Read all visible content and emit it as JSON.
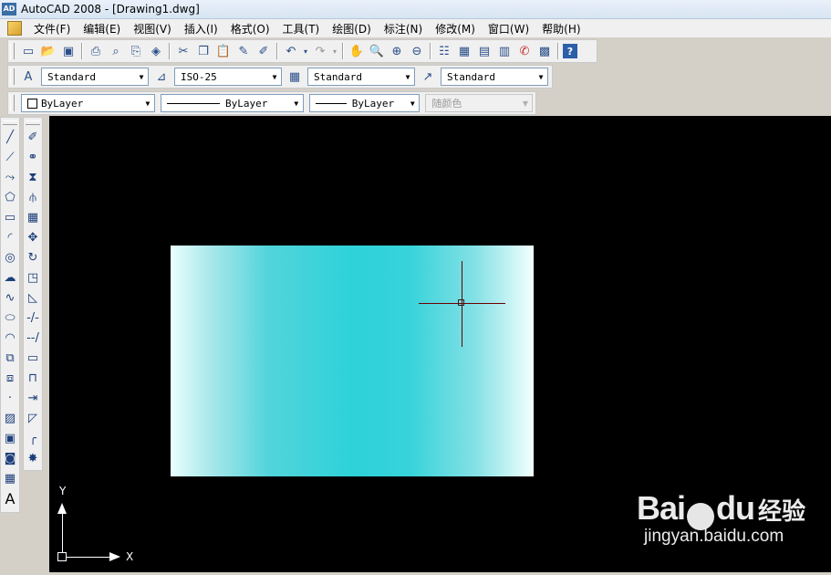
{
  "window": {
    "title": "AutoCAD 2008 - [Drawing1.dwg]",
    "logo_text": "AD"
  },
  "menu": {
    "items": [
      "文件(F)",
      "编辑(E)",
      "视图(V)",
      "插入(I)",
      "格式(O)",
      "工具(T)",
      "绘图(D)",
      "标注(N)",
      "修改(M)",
      "窗口(W)",
      "帮助(H)"
    ]
  },
  "standard_toolbar": {
    "icons": [
      "new-icon",
      "open-icon",
      "save-icon",
      "plot-icon",
      "plot-preview-icon",
      "publish-icon",
      "3d-dwf-icon",
      "cut-icon",
      "copy-icon",
      "paste-icon",
      "match-properties-icon",
      "block-editor-icon",
      "undo-icon",
      "redo-icon",
      "pan-icon",
      "zoom-realtime-icon",
      "zoom-window-icon",
      "zoom-previous-icon",
      "properties-icon",
      "design-center-icon",
      "tool-palettes-icon",
      "sheet-set-icon",
      "markup-icon",
      "calculator-icon",
      "help-icon"
    ]
  },
  "styles_toolbar": {
    "text_style": "Standard",
    "dim_style": "ISO-25",
    "table_style": "Standard",
    "multileader_style": "Standard"
  },
  "properties_toolbar": {
    "layer": "ByLayer",
    "linetype": "ByLayer",
    "lineweight": "ByLayer",
    "plot_style": "随颜色"
  },
  "draw_toolbar": {
    "icons": [
      "line-icon",
      "construction-line-icon",
      "polyline-icon",
      "polygon-icon",
      "rectangle-icon",
      "arc-icon",
      "circle-icon",
      "revision-cloud-icon",
      "spline-icon",
      "ellipse-icon",
      "ellipse-arc-icon",
      "insert-block-icon",
      "make-block-icon",
      "point-icon",
      "hatch-icon",
      "gradient-icon",
      "region-icon",
      "table-icon",
      "multiline-text-icon"
    ]
  },
  "modify_toolbar": {
    "icons": [
      "erase-icon",
      "copy-object-icon",
      "mirror-icon",
      "offset-icon",
      "array-icon",
      "move-icon",
      "rotate-icon",
      "scale-icon",
      "stretch-icon",
      "trim-icon",
      "extend-icon",
      "break-at-point-icon",
      "break-icon",
      "join-icon",
      "chamfer-icon",
      "fillet-icon",
      "explode-icon"
    ]
  },
  "canvas": {
    "background": "#000000",
    "ucs_y": "Y",
    "ucs_x": "X"
  },
  "watermark": {
    "brand": "Bai",
    "brand2": "du",
    "cn": "经验",
    "url": "jingyan.baidu.com"
  }
}
